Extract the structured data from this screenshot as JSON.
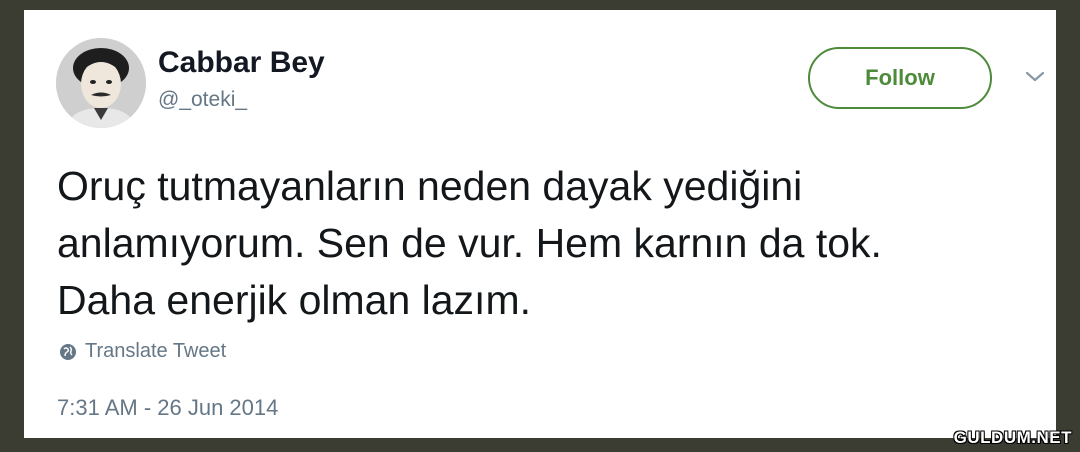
{
  "tweet": {
    "author": {
      "display_name": "Cabbar Bey",
      "handle": "@_oteki_",
      "avatar_icon": "profile-photo"
    },
    "follow_button_label": "Follow",
    "menu_icon": "chevron-down-icon",
    "text_lines": [
      "Oruç tutmayanların neden dayak yediğini",
      "anlamıyorum. Sen de vur. Hem karnın da tok.",
      "Daha enerjik olman lazım."
    ],
    "translate_label": "Translate Tweet",
    "translate_icon": "globe-icon",
    "timestamp": "7:31 AM - 26 Jun 2014"
  },
  "watermark": "GULDUM.NET",
  "colors": {
    "background": "#3b3d33",
    "follow_accent": "#4d8a3a",
    "secondary_text": "#657786"
  }
}
